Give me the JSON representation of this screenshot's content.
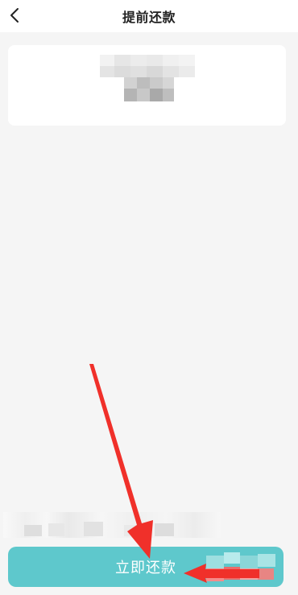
{
  "header": {
    "title": "提前还款",
    "back_icon": "chevron-left-icon"
  },
  "footer": {
    "pay_button_label": "立即还款"
  },
  "colors": {
    "accent": "#5ec8cc",
    "annotation_arrow": "#f0302a",
    "background": "#f5f5f5"
  }
}
